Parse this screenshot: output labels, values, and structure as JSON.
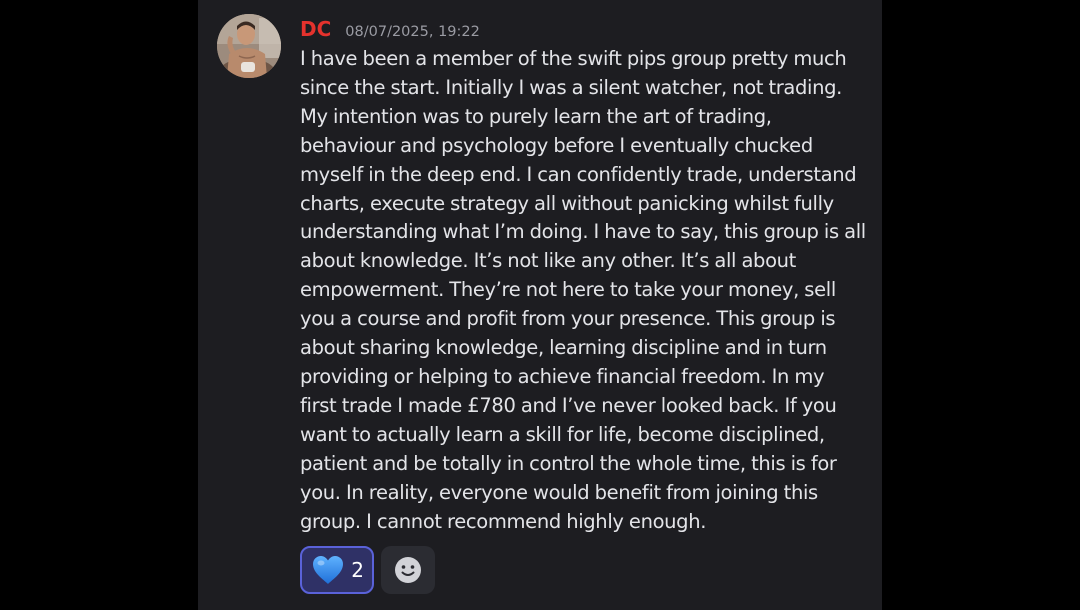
{
  "message": {
    "username": "DC",
    "username_color": "#e5322d",
    "timestamp": "08/07/2025, 19:22",
    "lines": [
      "I have been a member of the swift pips group pretty much",
      "since the start. Initially I was a silent watcher, not trading.",
      "My intention was to purely learn the art of trading,",
      "behaviour and psychology before I eventually chucked",
      "myself in the deep end. I can confidently trade, understand",
      "charts, execute strategy all without panicking whilst fully",
      "understanding what I’m doing. I have to say, this group is all",
      "about knowledge. It’s not like any other. It’s all about",
      "empowerment. They’re not here to take your money, sell",
      "you a course and profit from your presence. This group is",
      "about sharing knowledge, learning discipline and in turn",
      "providing or helping to achieve financial freedom. In my",
      "first trade I made £780 and I’ve never looked back. If you",
      "want to actually learn a skill for life, become disciplined,",
      "patient and be totally in control the whole time, this is for",
      "you. In reality, everyone would benefit from joining this",
      "group. I cannot recommend highly enough."
    ]
  },
  "reactions": [
    {
      "icon": "blue-heart-icon",
      "count": "2",
      "active": true,
      "color": "#3b8ef0"
    },
    {
      "icon": "add-reaction-smiley-icon",
      "count": null,
      "active": false
    }
  ],
  "colors": {
    "background": "#000000",
    "panel": "#1d1d21",
    "text": "#e3e4e8",
    "timestamp": "#9a9ba3",
    "reaction_active_bg": "#2f3166",
    "reaction_active_border": "#5a62d9"
  }
}
